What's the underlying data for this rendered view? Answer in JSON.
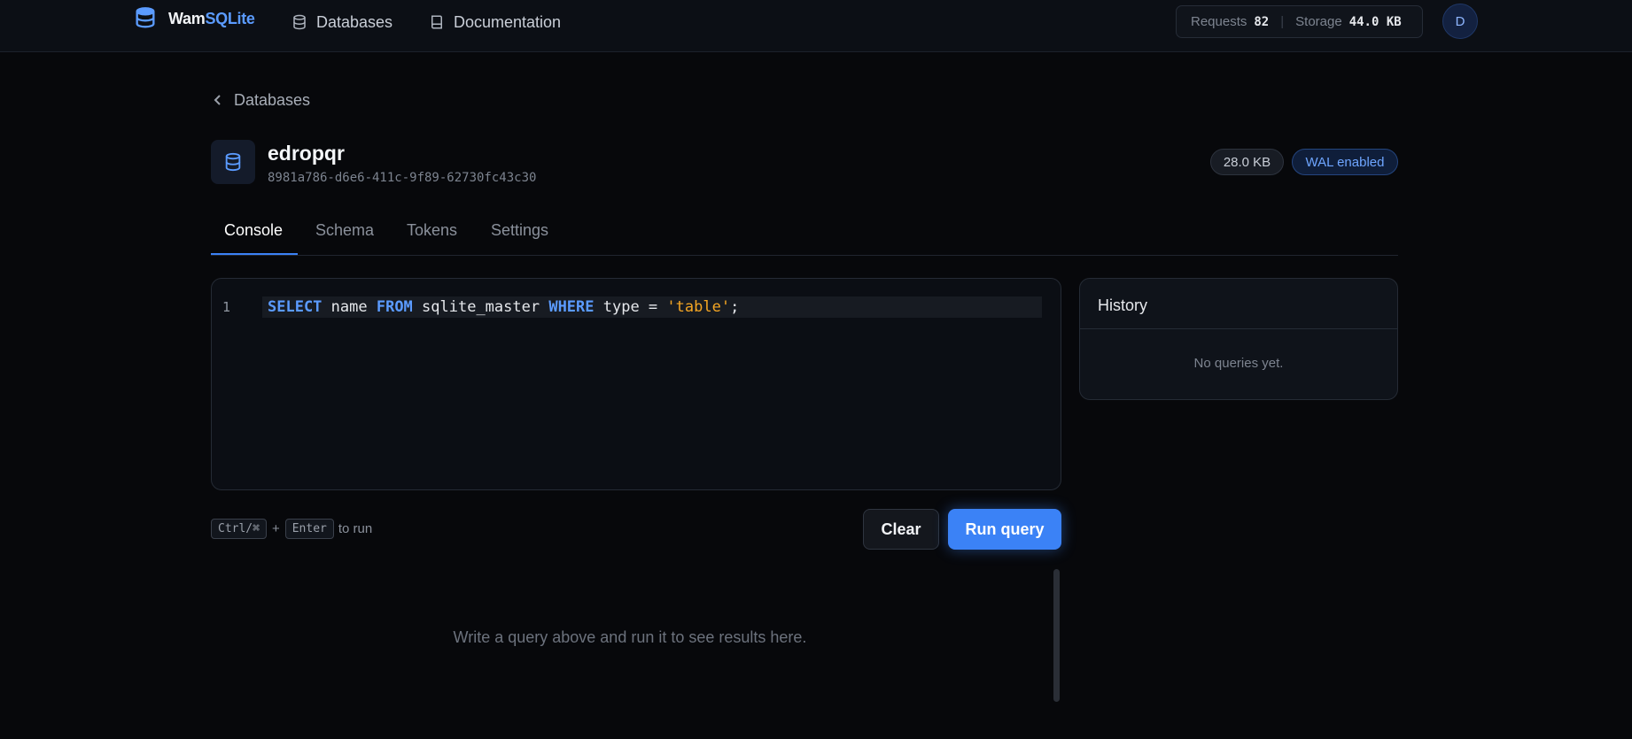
{
  "brand": {
    "prefix": "Wam",
    "suffix": "SQLite",
    "icon": "database-icon",
    "accent_color": "#5b9bff"
  },
  "nav": {
    "links": [
      {
        "label": "Databases",
        "icon": "database-icon"
      },
      {
        "label": "Documentation",
        "icon": "book-icon"
      }
    ]
  },
  "usage": {
    "requests_label": "Requests",
    "requests_value": "82",
    "separator": "|",
    "storage_label": "Storage",
    "storage_value": "44.0 KB"
  },
  "user": {
    "avatar_initial": "D"
  },
  "breadcrumb": {
    "label": "Databases",
    "icon": "chevron-left-icon"
  },
  "database": {
    "name": "edropqr",
    "id": "8981a786-d6e6-411c-9f89-62730fc43c30",
    "size_badge": "28.0 KB",
    "wal_badge": "WAL enabled"
  },
  "tabs": [
    {
      "label": "Console",
      "active": true
    },
    {
      "label": "Schema",
      "active": false
    },
    {
      "label": "Tokens",
      "active": false
    },
    {
      "label": "Settings",
      "active": false
    }
  ],
  "editor": {
    "line_number": "1",
    "tokens": {
      "kw1": "SELECT",
      "t1": " name ",
      "kw2": "FROM",
      "t2": " sqlite_master ",
      "kw3": "WHERE",
      "t3": " type = ",
      "str": "'table'",
      "t4": ";"
    }
  },
  "history": {
    "title": "History",
    "empty": "No queries yet."
  },
  "shortcut": {
    "key1": "Ctrl/⌘",
    "plus": "+",
    "key2": "Enter",
    "suffix": "to run"
  },
  "actions": {
    "clear": "Clear",
    "run": "Run query",
    "run_color": "#3b82f6"
  },
  "results": {
    "empty": "Write a query above and run it to see results here."
  }
}
